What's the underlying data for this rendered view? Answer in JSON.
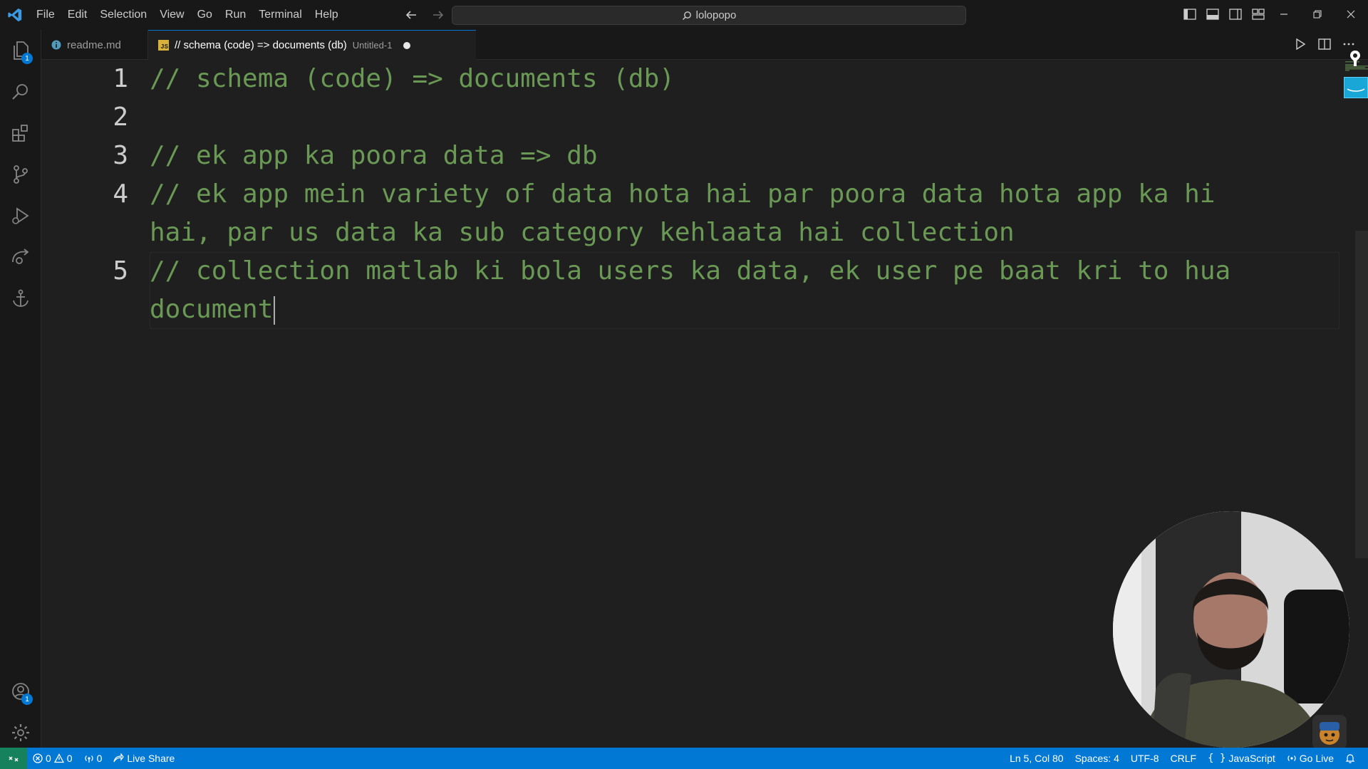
{
  "menu": [
    "File",
    "Edit",
    "Selection",
    "View",
    "Go",
    "Run",
    "Terminal",
    "Help"
  ],
  "search": {
    "text": "lolopopo"
  },
  "activity": {
    "explorer_badge": "1",
    "accounts_badge": "1"
  },
  "tabs": [
    {
      "label": "readme.md",
      "icon": "info-icon"
    },
    {
      "label": "// schema (code) => documents (db)",
      "description": "Untitled-1",
      "icon": "js-file-icon",
      "dirty": true
    }
  ],
  "editor": {
    "line_numbers": [
      "1",
      "2",
      "3",
      "4",
      "5"
    ],
    "lines": [
      "// schema (code) => documents (db)",
      "",
      "// ek app ka poora data => db",
      "// ek app mein variety of data hota hai par poora data hota app ka hi",
      "hai, par us data ka sub category kehlaata hai collection",
      "// collection matlab ki bola users ka data, ek user pe baat kri to hua",
      "document"
    ],
    "comment_color": "#6a9955"
  },
  "status": {
    "errors": "0",
    "warnings": "0",
    "ports": "0",
    "live_share": "Live Share",
    "position": "Ln 5, Col 80",
    "spaces": "Spaces: 4",
    "encoding": "UTF-8",
    "eol": "CRLF",
    "language": "JavaScript",
    "go_live": "Go Live",
    "accent": "#0078d4"
  }
}
